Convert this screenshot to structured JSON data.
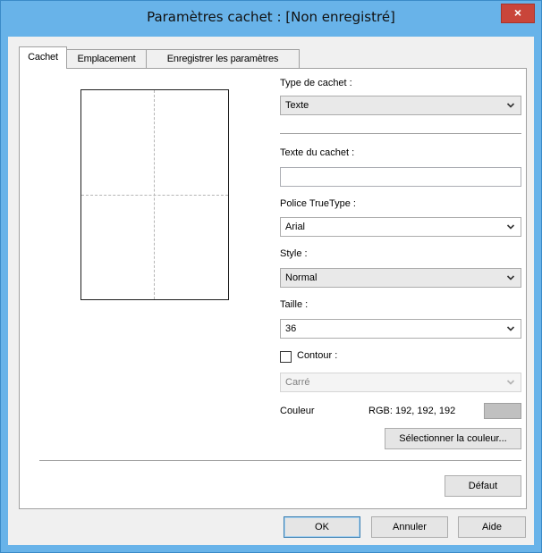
{
  "window": {
    "title": "Paramètres cachet : [Non enregistré]",
    "close_glyph": "×"
  },
  "tabs": [
    {
      "label": "Cachet",
      "active": true
    },
    {
      "label": "Emplacement",
      "active": false
    },
    {
      "label": "Enregistrer les paramètres",
      "active": false
    }
  ],
  "form": {
    "stamp_type_label": "Type de cachet :",
    "stamp_type_value": "Texte",
    "stamp_text_label": "Texte du cachet :",
    "stamp_text_value": "",
    "font_label": "Police TrueType :",
    "font_value": "Arial",
    "style_label": "Style :",
    "style_value": "Normal",
    "size_label": "Taille :",
    "size_value": "36",
    "outline_label": "Contour :",
    "outline_checked": false,
    "outline_value": "Carré",
    "color_label": "Couleur",
    "color_rgb_text": "RGB: 192, 192, 192",
    "color_swatch": "#c0c0c0",
    "select_color_button": "Sélectionner la couleur..."
  },
  "buttons": {
    "default": "Défaut",
    "ok": "OK",
    "cancel": "Annuler",
    "help": "Aide"
  },
  "colors": {
    "title_bar": "#68b3e9",
    "close_button": "#c9453a",
    "dialog_background": "#f0f0f0"
  }
}
